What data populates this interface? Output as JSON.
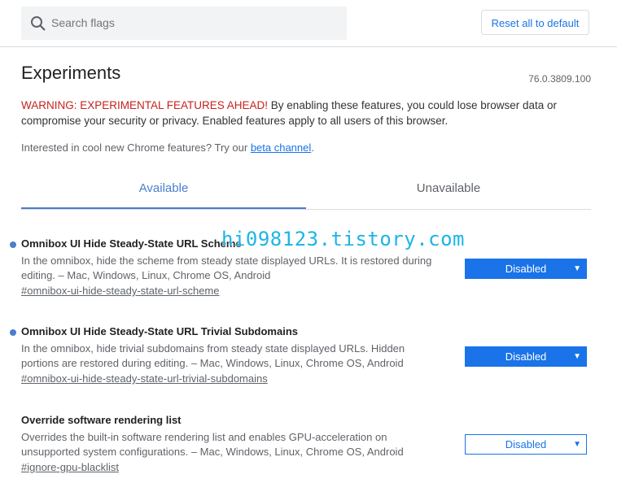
{
  "search": {
    "placeholder": "Search flags"
  },
  "header": {
    "reset_label": "Reset all to default"
  },
  "main": {
    "title": "Experiments",
    "version": "76.0.3809.100",
    "warning_label": "WARNING: EXPERIMENTAL FEATURES AHEAD!",
    "warning_text": " By enabling these features, you could lose browser data or compromise your security or privacy. Enabled features apply to all users of this browser.",
    "interest_text": "Interested in cool new Chrome features? Try our ",
    "interest_link": "beta channel",
    "interest_end": "."
  },
  "tabs": [
    {
      "label": "Available"
    },
    {
      "label": "Unavailable"
    }
  ],
  "watermark": "hi098123.tistory.com",
  "flags": [
    {
      "name": "Omnibox UI Hide Steady-State URL Scheme",
      "description": "In the omnibox, hide the scheme from steady state displayed URLs. It is restored during editing. – Mac, Windows, Linux, Chrome OS, Android",
      "link": "#omnibox-ui-hide-steady-state-url-scheme",
      "value": "Disabled"
    },
    {
      "name": "Omnibox UI Hide Steady-State URL Trivial Subdomains",
      "description": "In the omnibox, hide trivial subdomains from steady state displayed URLs. Hidden portions are restored during editing. – Mac, Windows, Linux, Chrome OS, Android",
      "link": "#omnibox-ui-hide-steady-state-url-trivial-subdomains",
      "value": "Disabled"
    },
    {
      "name": "Override software rendering list",
      "description": "Overrides the built-in software rendering list and enables GPU-acceleration on unsupported system configurations. – Mac, Windows, Linux, Chrome OS, Android",
      "link": "#ignore-gpu-blacklist",
      "value": "Disabled"
    }
  ],
  "icons": {
    "search": "search-icon",
    "dropdown": "chevron-down-icon"
  },
  "colors": {
    "accent": "#1a73e8",
    "warning": "#c5221f",
    "watermark": "#1db4e8"
  }
}
